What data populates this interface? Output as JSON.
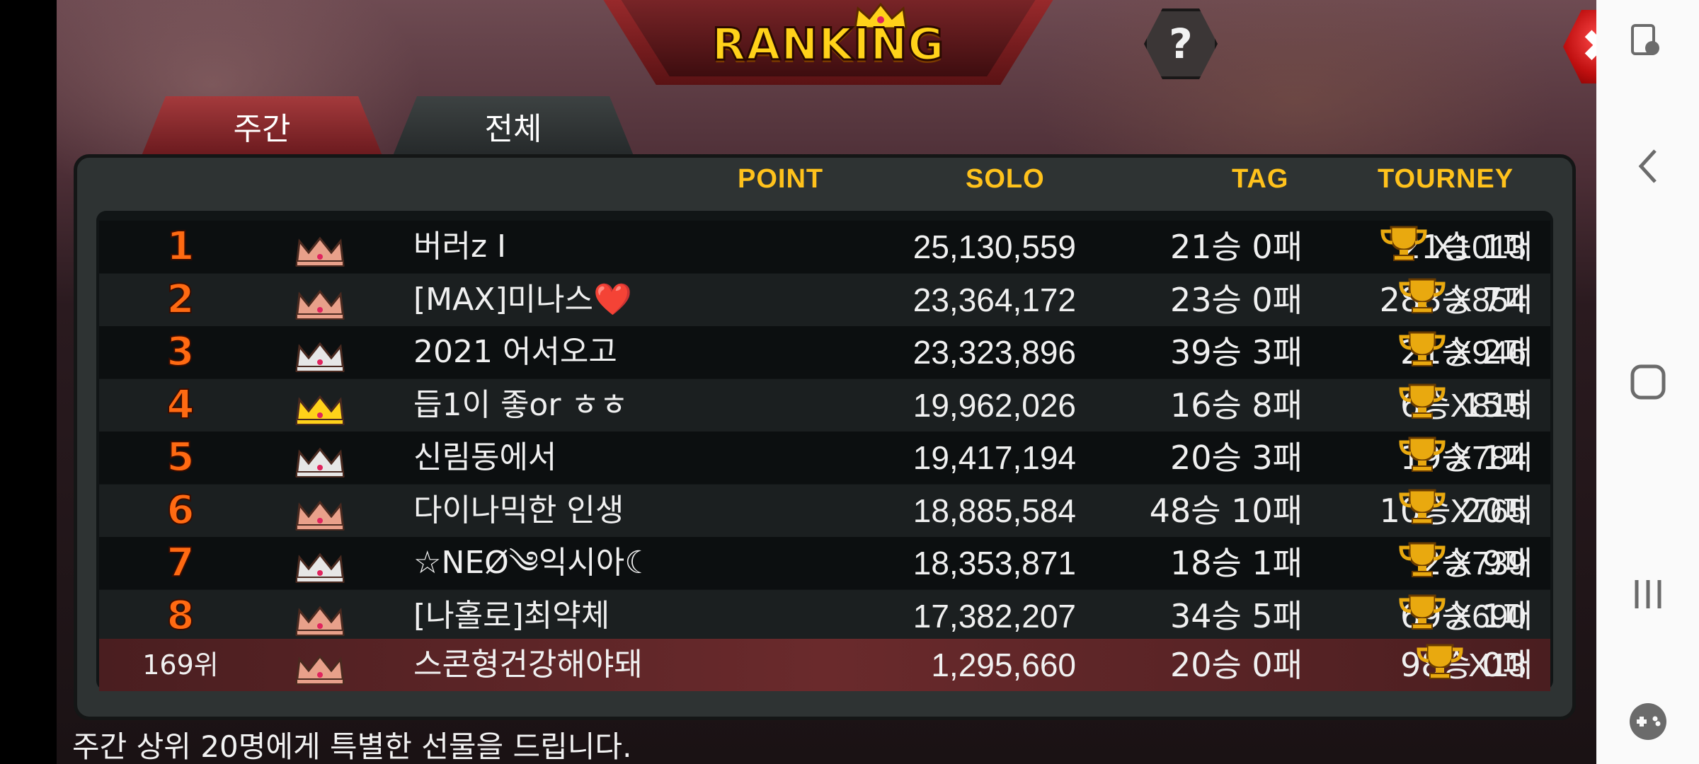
{
  "header": {
    "title": "RANKING",
    "help_label": "?",
    "close_label": "✖"
  },
  "tabs": [
    {
      "label": "주간",
      "active": true
    },
    {
      "label": "전체",
      "active": false
    }
  ],
  "columns": {
    "point": "POINT",
    "solo": "SOLO",
    "tag": "TAG",
    "tourney": "TOURNEY"
  },
  "rows": [
    {
      "rank": "1",
      "crown": "bronze",
      "name": "버러z I",
      "point": "25,130,559",
      "solo": "21승 0패",
      "tag": "21승 1패",
      "tourney": "X1013"
    },
    {
      "rank": "2",
      "crown": "bronze",
      "name": "[MAX]미나스❤️",
      "point": "23,364,172",
      "solo": "23승 0패",
      "tag": "288승 7패",
      "tourney": "X854"
    },
    {
      "rank": "3",
      "crown": "silver",
      "name": "2021 어서오고",
      "point": "23,323,896",
      "solo": "39승 3패",
      "tag": "21승 2패",
      "tourney": "X946"
    },
    {
      "rank": "4",
      "crown": "gold",
      "name": "듭1이 좋or ㅎㅎ",
      "point": "19,962,026",
      "solo": "16승 8패",
      "tag": "6승 15패",
      "tourney": "X815"
    },
    {
      "rank": "5",
      "crown": "silver",
      "name": "신림동에서",
      "point": "19,417,194",
      "solo": "20승 3패",
      "tag": "19승 1패",
      "tourney": "X784"
    },
    {
      "rank": "6",
      "crown": "bronze",
      "name": "다이나믹한 인생",
      "point": "18,885,584",
      "solo": "48승 10패",
      "tag": "10승 20패",
      "tourney": "X765"
    },
    {
      "rank": "7",
      "crown": "silver",
      "name": "☆NEØ༄익시아☾",
      "point": "18,353,871",
      "solo": "18승 1패",
      "tag": "2승 9패",
      "tourney": "X739"
    },
    {
      "rank": "8",
      "crown": "bronze",
      "name": "[나홀로]최약체",
      "point": "17,382,207",
      "solo": "34승 5패",
      "tag": "69승 1패",
      "tourney": "X690"
    }
  ],
  "my_row": {
    "rank": "169위",
    "crown": "bronze",
    "name": "스콘형건강해야돼",
    "point": "1,295,660",
    "solo": "20승 0패",
    "tag": "98승 0패",
    "tourney": "X13"
  },
  "footer": {
    "text": "주간 상위 20명에게 특별한 선물을 드립니다."
  },
  "colors": {
    "crown_gold": "#ffd21a",
    "crown_silver": "#e6e6e6",
    "crown_bronze": "#e8a08a",
    "rank_orange": "#ff6a12",
    "header_yellow": "#ffc21c"
  }
}
